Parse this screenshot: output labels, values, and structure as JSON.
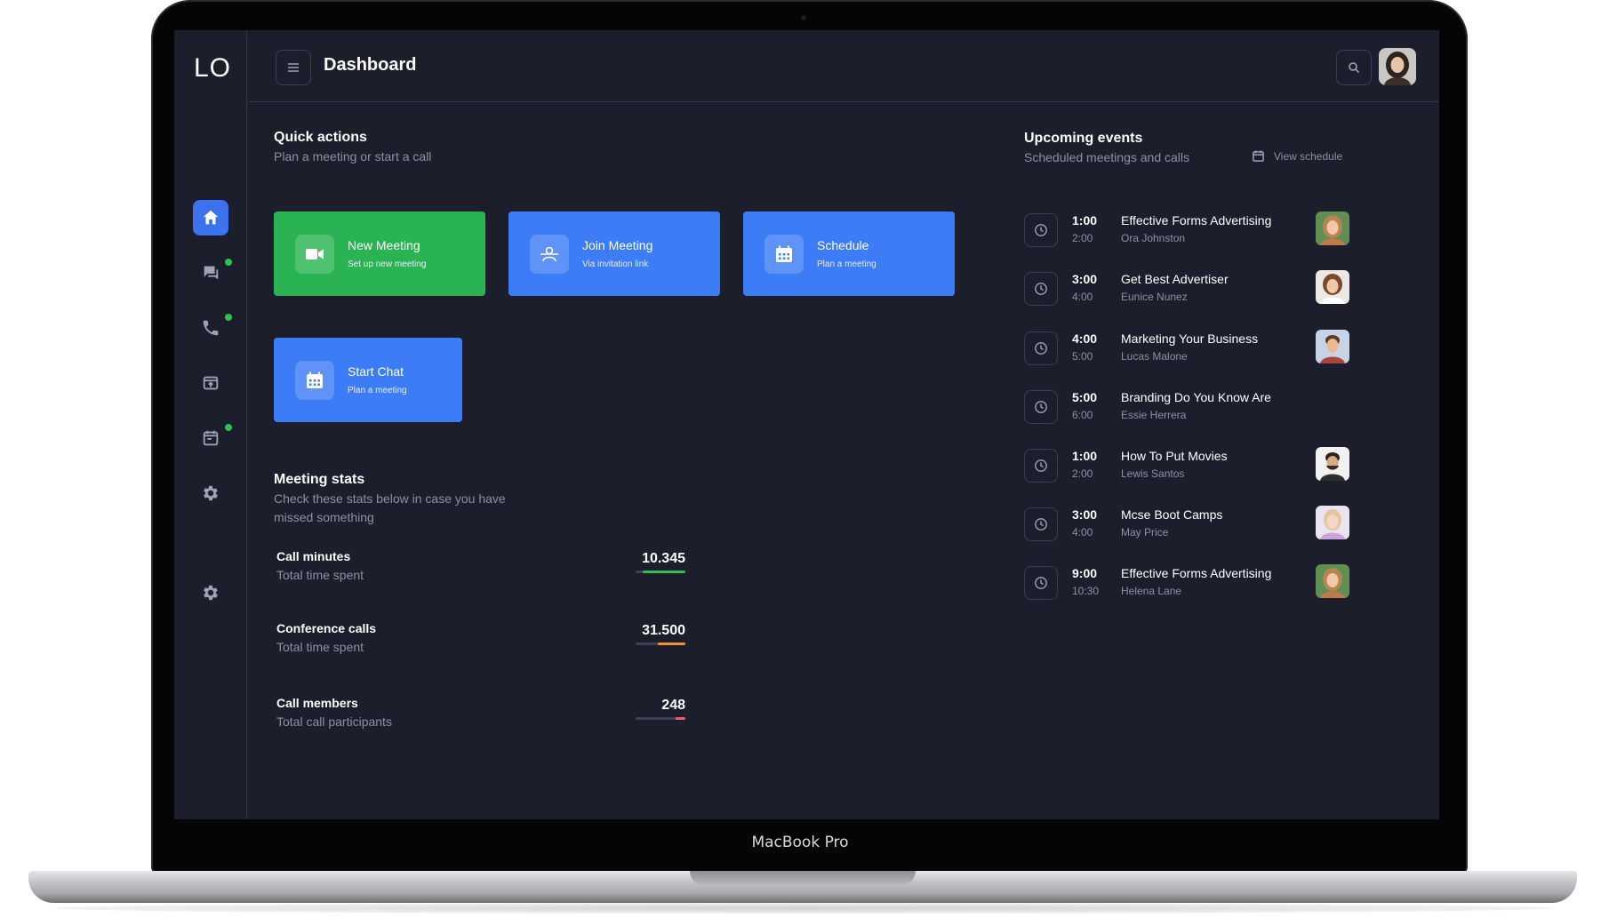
{
  "device": {
    "label": "MacBook Pro"
  },
  "app": {
    "logo": "LO",
    "page_title": "Dashboard"
  },
  "sidebar": {
    "items": [
      {
        "icon": "home-icon",
        "active": true,
        "badge": false
      },
      {
        "icon": "chat-icon",
        "active": false,
        "badge": true
      },
      {
        "icon": "phone-icon",
        "active": false,
        "badge": true
      },
      {
        "icon": "screen-share-icon",
        "active": false,
        "badge": false
      },
      {
        "icon": "calendar-icon",
        "active": false,
        "badge": true
      },
      {
        "icon": "gear-icon",
        "active": false,
        "badge": false
      }
    ],
    "footer_icon": "gear-icon"
  },
  "colors": {
    "accent": "#3d72ee",
    "green": "#2ab352",
    "blue": "#3d7cf7",
    "background": "#1c1f2b",
    "badge": "#2fbf57"
  },
  "quick_actions": {
    "title": "Quick actions",
    "subtitle": "Plan a meeting or start a call",
    "cards": [
      {
        "label": "New Meeting",
        "sub": "Set up new meeting",
        "icon": "video-camera-icon",
        "color": "green"
      },
      {
        "label": "Join Meeting",
        "sub": "Via invitation link",
        "icon": "users-icon",
        "color": "blue"
      },
      {
        "label": "Schedule",
        "sub": "Plan a meeting",
        "icon": "calendar-icon",
        "color": "blue"
      },
      {
        "label": "Start Chat",
        "sub": "Plan a meeting",
        "icon": "calendar-icon",
        "color": "blue"
      }
    ]
  },
  "meeting_stats": {
    "title": "Meeting stats",
    "subtitle_line1": "Check these stats below in case you have",
    "subtitle_line2": "missed something",
    "rows": [
      {
        "label": "Call minutes",
        "sub": "Total time spent",
        "value": "10.345",
        "progress": 0.85,
        "color": "#2fbf57"
      },
      {
        "label": "Conference calls",
        "sub": "Total time spent",
        "value": "31.500",
        "progress": 0.55,
        "color": "#f0913a"
      },
      {
        "label": "Call members",
        "sub": "Total call participants",
        "value": "248",
        "progress": 0.2,
        "color": "#ef5d6e"
      }
    ]
  },
  "upcoming_events": {
    "title": "Upcoming events",
    "subtitle": "Scheduled meetings and calls",
    "view_schedule": "View schedule",
    "events": [
      {
        "start": "1:00",
        "end": "2:00",
        "title": "Effective Forms Advertising",
        "person": "Ora Johnston",
        "avatar": "avatar-woman-1"
      },
      {
        "start": "3:00",
        "end": "4:00",
        "title": "Get Best Advertiser",
        "person": "Eunice Nunez",
        "avatar": "avatar-woman-2"
      },
      {
        "start": "4:00",
        "end": "5:00",
        "title": "Marketing Your Business",
        "person": "Lucas Malone",
        "avatar": "avatar-man-1"
      },
      {
        "start": "5:00",
        "end": "6:00",
        "title": "Branding Do You Know Are",
        "person": "Essie Herrera",
        "avatar": ""
      },
      {
        "start": "1:00",
        "end": "2:00",
        "title": "How To Put Movies",
        "person": "Lewis Santos",
        "avatar": "avatar-man-2"
      },
      {
        "start": "3:00",
        "end": "4:00",
        "title": "Mcse Boot Camps",
        "person": "May Price",
        "avatar": "avatar-woman-3"
      },
      {
        "start": "9:00",
        "end": "10:30",
        "title": "Effective Forms Advertising",
        "person": "Helena Lane",
        "avatar": "avatar-woman-1"
      }
    ]
  }
}
